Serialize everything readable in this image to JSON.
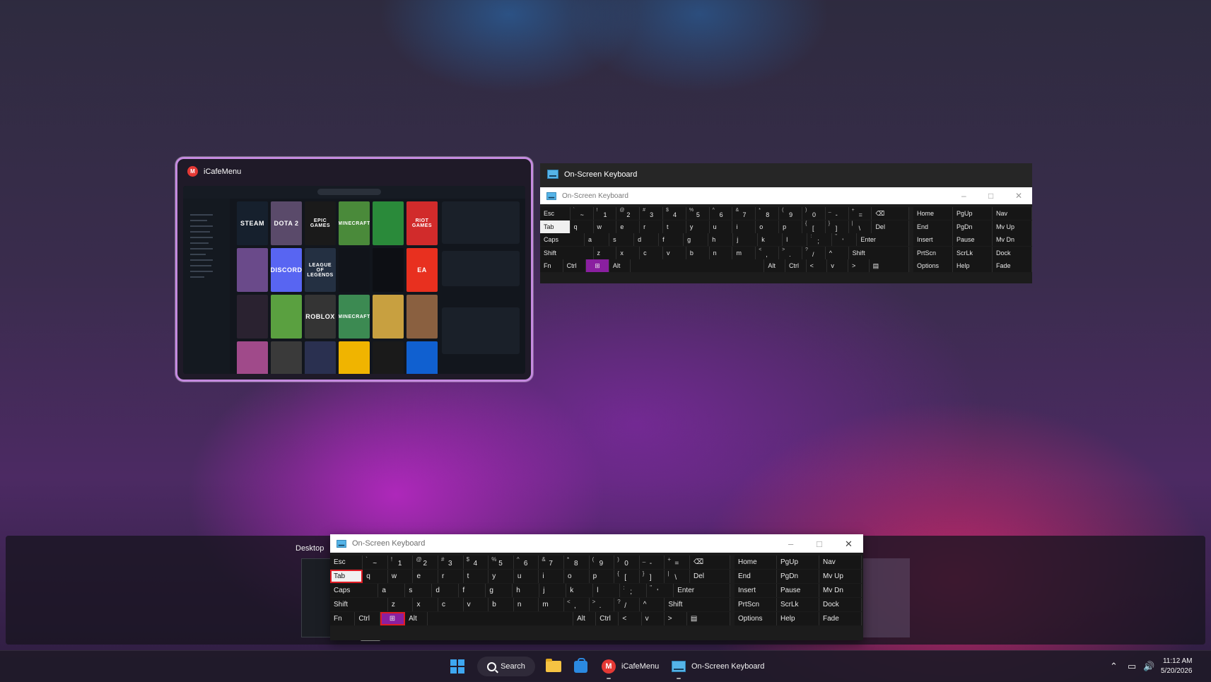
{
  "taskview": {
    "icafe_title": "iCafeMenu",
    "osk_title": "On-Screen Keyboard",
    "icafe_tiles": [
      {
        "label": "STEAM",
        "bg": "#16202d"
      },
      {
        "label": "DOTA 2",
        "bg": "#5a4a6a"
      },
      {
        "label": "EPIC GAMES",
        "bg": "#1a1a1a"
      },
      {
        "label": "MINECRAFT",
        "bg": "#4a8a3a"
      },
      {
        "label": "",
        "bg": "#2a8a3a"
      },
      {
        "label": "RIOT GAMES",
        "bg": "#d12b2b"
      },
      {
        "label": "",
        "bg": "#6a4a8a"
      },
      {
        "label": "DISCORD",
        "bg": "#5865f2"
      },
      {
        "label": "LEAGUE OF LEGENDS",
        "bg": "#243042"
      },
      {
        "label": "",
        "bg": "#11141a"
      },
      {
        "label": "",
        "bg": "#0d0f14"
      },
      {
        "label": "EA",
        "bg": "#e8301f"
      },
      {
        "label": "",
        "bg": "#2a2230"
      },
      {
        "label": "",
        "bg": "#5aa040"
      },
      {
        "label": "ROBLOX",
        "bg": "#343434"
      },
      {
        "label": "MINECRAFT",
        "bg": "#3c8a52"
      },
      {
        "label": "",
        "bg": "#c8a040"
      },
      {
        "label": "",
        "bg": "#8a6040"
      },
      {
        "label": "",
        "bg": "#a04a8a"
      },
      {
        "label": "",
        "bg": "#3a3a3a"
      },
      {
        "label": "",
        "bg": "#2a3050"
      },
      {
        "label": "",
        "bg": "#f0b400"
      },
      {
        "label": "",
        "bg": "#1a1a1a"
      },
      {
        "label": "",
        "bg": "#1060d0"
      }
    ]
  },
  "osk": {
    "window_title": "On-Screen Keyboard",
    "controls": {
      "minimize": "–",
      "maximize": "□",
      "close": "✕"
    },
    "rows": [
      [
        {
          "l": "Esc",
          "w": 1.3
        },
        {
          "l": "~",
          "s": "`",
          "w": 1
        },
        {
          "l": "1",
          "s": "!",
          "w": 1
        },
        {
          "l": "2",
          "s": "@",
          "w": 1
        },
        {
          "l": "3",
          "s": "#",
          "w": 1
        },
        {
          "l": "4",
          "s": "$",
          "w": 1
        },
        {
          "l": "5",
          "s": "%",
          "w": 1
        },
        {
          "l": "6",
          "s": "^",
          "w": 1
        },
        {
          "l": "7",
          "s": "&",
          "w": 1
        },
        {
          "l": "8",
          "s": "*",
          "w": 1
        },
        {
          "l": "9",
          "s": "(",
          "w": 1
        },
        {
          "l": "0",
          "s": ")",
          "w": 1
        },
        {
          "l": "-",
          "s": "_",
          "w": 1
        },
        {
          "l": "=",
          "s": "+",
          "w": 1
        },
        {
          "l": "⌫",
          "w": 1.6
        }
      ],
      [
        {
          "l": "Tab",
          "w": 1.3,
          "tab": true
        },
        {
          "l": "q",
          "w": 1
        },
        {
          "l": "w",
          "w": 1
        },
        {
          "l": "e",
          "w": 1
        },
        {
          "l": "r",
          "w": 1
        },
        {
          "l": "t",
          "w": 1
        },
        {
          "l": "y",
          "w": 1
        },
        {
          "l": "u",
          "w": 1
        },
        {
          "l": "i",
          "w": 1
        },
        {
          "l": "o",
          "w": 1
        },
        {
          "l": "p",
          "w": 1
        },
        {
          "l": "[",
          "s": "{",
          "w": 1
        },
        {
          "l": "]",
          "s": "}",
          "w": 1
        },
        {
          "l": "\\",
          "s": "|",
          "w": 1
        },
        {
          "l": "Del",
          "w": 1.6
        }
      ],
      [
        {
          "l": "Caps",
          "w": 1.8
        },
        {
          "l": "a",
          "w": 1
        },
        {
          "l": "s",
          "w": 1
        },
        {
          "l": "d",
          "w": 1
        },
        {
          "l": "f",
          "w": 1
        },
        {
          "l": "g",
          "w": 1
        },
        {
          "l": "h",
          "w": 1
        },
        {
          "l": "j",
          "w": 1
        },
        {
          "l": "k",
          "w": 1
        },
        {
          "l": "l",
          "w": 1
        },
        {
          "l": ";",
          "s": ":",
          "w": 1
        },
        {
          "l": "'",
          "s": "\"",
          "w": 1
        },
        {
          "l": "Enter",
          "w": 2.1
        }
      ],
      [
        {
          "l": "Shift",
          "w": 2.3
        },
        {
          "l": "z",
          "w": 1
        },
        {
          "l": "x",
          "w": 1
        },
        {
          "l": "c",
          "w": 1
        },
        {
          "l": "v",
          "w": 1
        },
        {
          "l": "b",
          "w": 1
        },
        {
          "l": "n",
          "w": 1
        },
        {
          "l": "m",
          "w": 1
        },
        {
          "l": ",",
          "s": "<",
          "w": 1
        },
        {
          "l": ".",
          "s": ">",
          "w": 1
        },
        {
          "l": "/",
          "s": "?",
          "w": 1
        },
        {
          "l": "^",
          "w": 1
        },
        {
          "l": "Shift",
          "w": 2.6
        }
      ],
      [
        {
          "l": "Fn",
          "w": 1.1
        },
        {
          "l": "Ctrl",
          "w": 1.1
        },
        {
          "l": "⊞",
          "w": 1.1,
          "hl": true
        },
        {
          "l": "Alt",
          "w": 1
        },
        {
          "l": "",
          "w": 6.4
        },
        {
          "l": "Alt",
          "w": 1
        },
        {
          "l": "Ctrl",
          "w": 1
        },
        {
          "l": "<",
          "w": 1
        },
        {
          "l": "v",
          "w": 1
        },
        {
          "l": ">",
          "w": 1
        },
        {
          "l": "▤",
          "w": 1.9
        }
      ]
    ],
    "nav_rows": [
      [
        "Home",
        "PgUp",
        "Nav"
      ],
      [
        "End",
        "PgDn",
        "Mv Up"
      ],
      [
        "Insert",
        "Pause",
        "Mv Dn"
      ],
      [
        "PrtScn",
        "ScrLk",
        "Dock"
      ],
      [
        "Options",
        "Help",
        "Fade"
      ]
    ]
  },
  "desktops": {
    "label": "Desktop"
  },
  "taskbar": {
    "search_label": "Search",
    "icafe_label": "iCafeMenu",
    "osk_label": "On-Screen Keyboard",
    "time": "11:12 AM",
    "date": "5/20/2026"
  },
  "colors": {
    "accent_purple": "#8a1fa0",
    "highlight_red": "#e01b24",
    "windows_blue": "#3ea7f0"
  }
}
